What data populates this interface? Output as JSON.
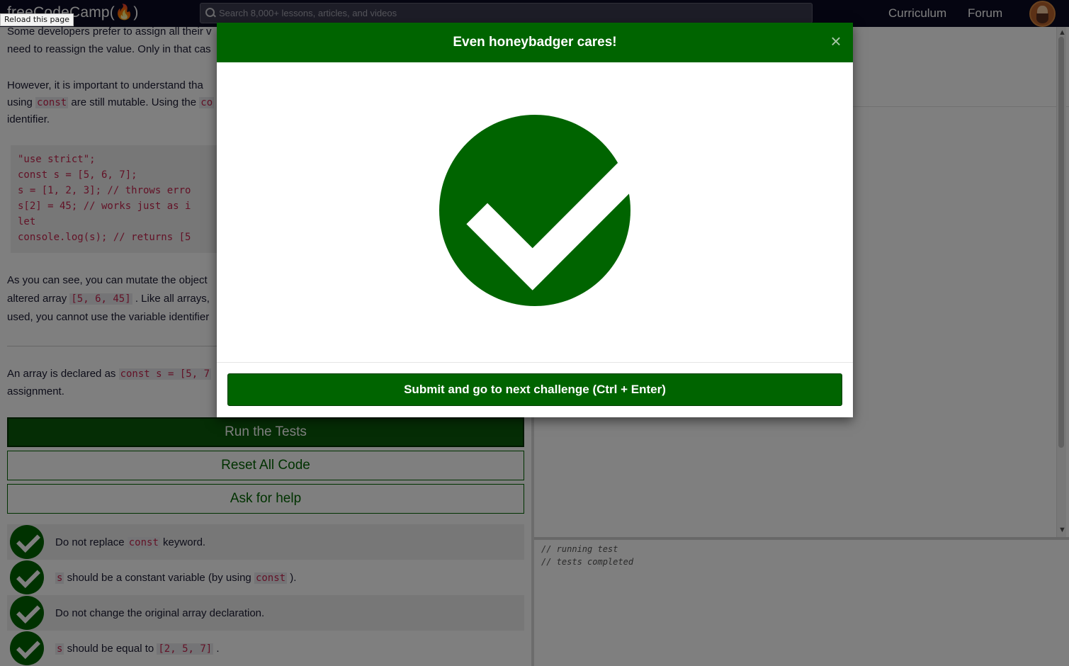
{
  "nav": {
    "logo_text": "freeCodeCamp(🔥)",
    "reload_tooltip": "Reload this page",
    "search_placeholder": "Search 8,000+ lessons, articles, and videos",
    "links": [
      "Curriculum",
      "Forum"
    ]
  },
  "lesson": {
    "p1_a": "Some developers prefer to assign all their v",
    "p1_b": "need to reassign the value. Only in that cas",
    "p2_a": "However, it is important to understand tha",
    "p2_b_pre": "using ",
    "p2_b_code": "const",
    "p2_b_post": " are still mutable. Using the ",
    "p2_b_code2": "co",
    "p2_c": "identifier.",
    "code_lines": [
      "\"use strict\";",
      "const s = [5, 6, 7];",
      "s = [1, 2, 3]; // throws erro",
      "s[2] = 45; // works just as i",
      "let",
      "console.log(s); // returns [5"
    ],
    "p3_a": "As you can see, you can mutate the object ",
    "p3_b_pre": "altered array ",
    "p3_b_code": "[5, 6, 45]",
    "p3_b_post": " . Like all arrays,",
    "p3_c": "used, you cannot use the variable identifier",
    "p4_a_pre": "An array is declared as ",
    "p4_a_code": "const s = [5, 7",
    "p4_b": "assignment."
  },
  "buttons": {
    "run": "Run the Tests",
    "reset": "Reset All Code",
    "help": "Ask for help"
  },
  "tests": [
    {
      "pre": "Do not replace ",
      "code": "const",
      "post": " keyword."
    },
    {
      "code0": "s",
      "pre": " should be a constant variable (by using ",
      "code": "const",
      "post": " )."
    },
    {
      "pre": "Do not change the original array declaration."
    },
    {
      "code0": "s",
      "pre": " should be equal to ",
      "code": "[2, 5, 7]",
      "post": " ."
    }
  ],
  "console_lines": [
    "// running test",
    "// tests completed"
  ],
  "modal": {
    "title": "Even honeybadger cares!",
    "close": "×",
    "submit": "Submit and go to next challenge (Ctrl + Enter)"
  },
  "colors": {
    "brand_green": "#006400",
    "nav_bg": "#0a0a23",
    "code_red": "#c7254e"
  }
}
